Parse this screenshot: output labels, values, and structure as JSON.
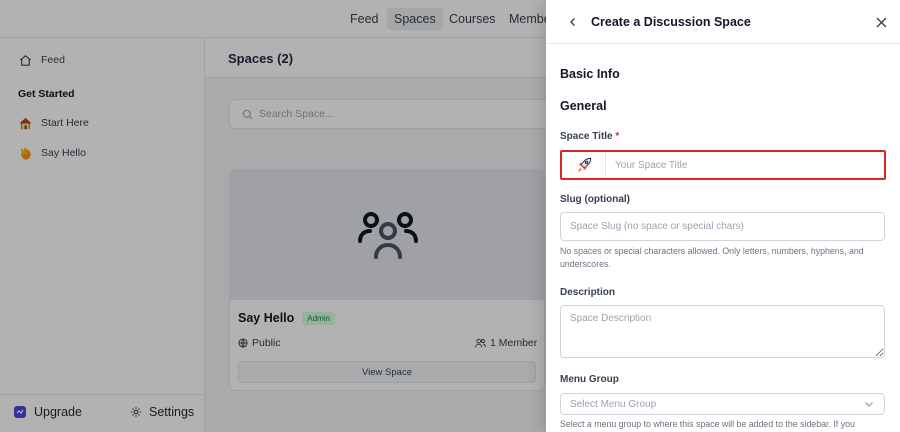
{
  "topnav": {
    "links": [
      {
        "label": "Feed"
      },
      {
        "label": "Spaces",
        "active": true
      },
      {
        "label": "Courses"
      },
      {
        "label": "Membe"
      }
    ]
  },
  "sidebar": {
    "feed_label": "Feed",
    "heading": "Get Started",
    "items": [
      {
        "label": "Start Here",
        "icon": "house-emoji-icon"
      },
      {
        "label": "Say Hello",
        "icon": "waving-hand-emoji-icon"
      }
    ],
    "upgrade_label": "Upgrade",
    "settings_label": "Settings"
  },
  "main": {
    "title": "Spaces (2)",
    "search_placeholder": "Search Space...",
    "card": {
      "name": "Say Hello",
      "badge": "Admin",
      "privacy": "Public",
      "members": "1 Member",
      "button": "View Space"
    }
  },
  "drawer": {
    "title": "Create a Discussion Space",
    "sections": {
      "basic_info": "Basic Info",
      "general": "General"
    },
    "space_title": {
      "label": "Space Title",
      "required_mark": "*",
      "placeholder": "Your Space Title",
      "emoji": "🚀"
    },
    "slug": {
      "label": "Slug (optional)",
      "placeholder": "Space Slug (no space or special chars)",
      "help": "No spaces or special characters allowed. Only letters, numbers, hyphens, and underscores."
    },
    "description": {
      "label": "Description",
      "placeholder": "Space Description"
    },
    "menu_group": {
      "label": "Menu Group",
      "placeholder": "Select Menu Group",
      "help": "Select a menu group to where this space will be added to the sidebar. If you"
    }
  },
  "colors": {
    "highlight_border": "#dc2626",
    "overlay": "rgba(0,0,0,0.30)",
    "upgrade_badge": "#4f46e5",
    "admin_badge_text": "#15803d"
  }
}
